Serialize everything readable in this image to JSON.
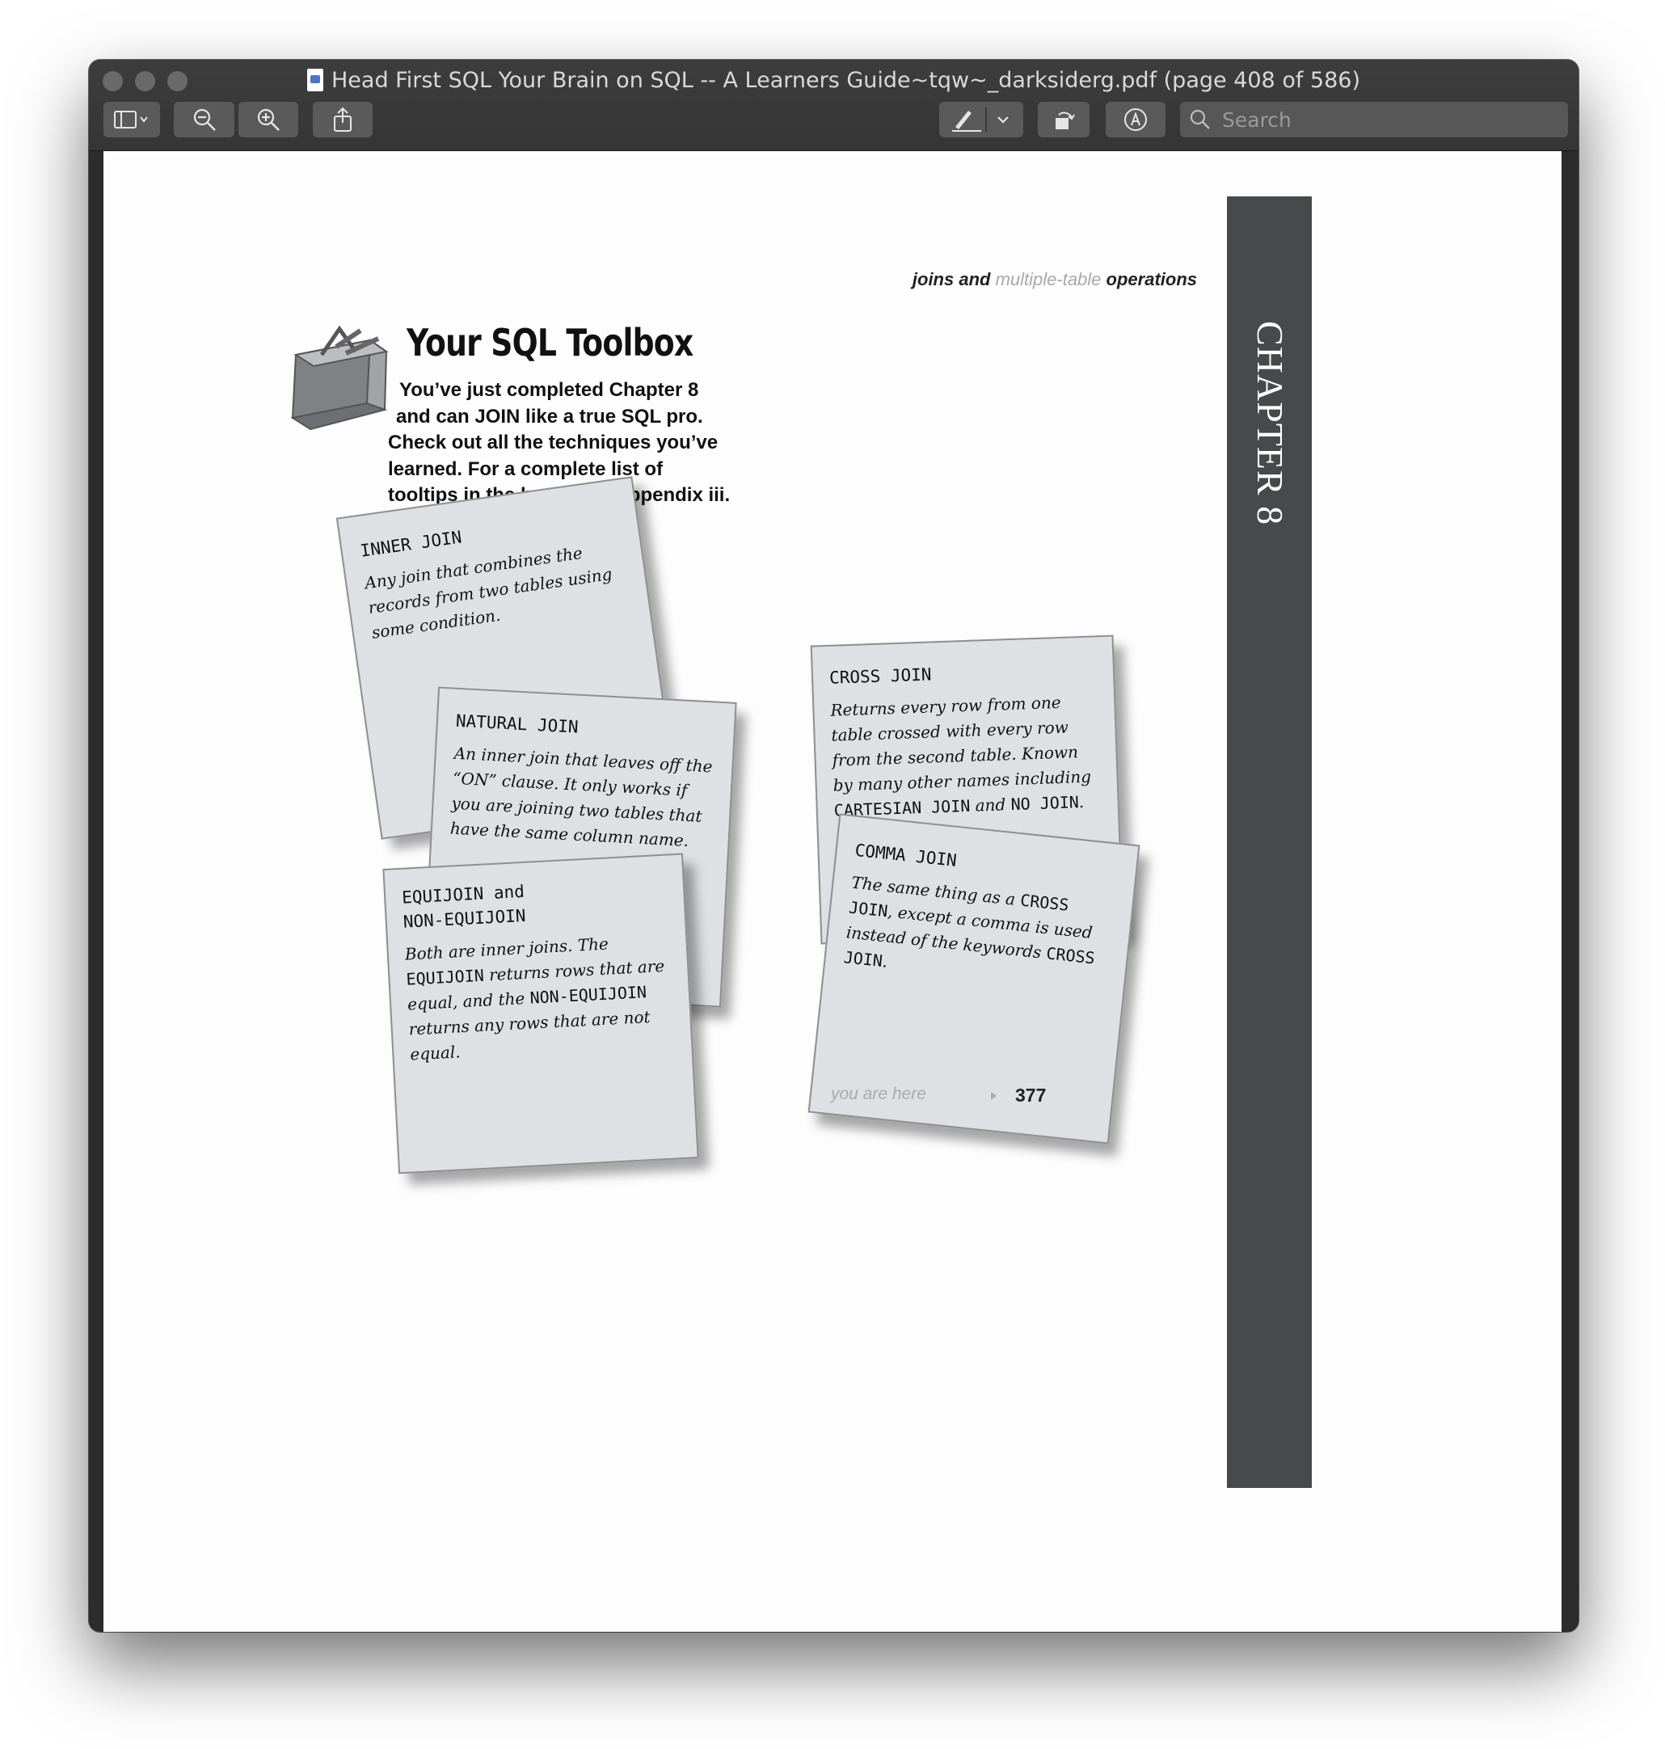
{
  "window": {
    "title": "Head First SQL Your Brain on SQL -- A Learners Guide~tqw~_darksiderg.pdf (page 408 of 586)"
  },
  "toolbar": {
    "buttons": [
      {
        "name": "sidebar-toggle",
        "icon": "sidebar-icon"
      },
      {
        "name": "zoom-out",
        "icon": "zoom-out-icon"
      },
      {
        "name": "zoom-in",
        "icon": "zoom-in-icon"
      },
      {
        "name": "share",
        "icon": "share-icon"
      },
      {
        "name": "markup-pen",
        "icon": "pen-icon"
      },
      {
        "name": "rotate",
        "icon": "rotate-icon"
      },
      {
        "name": "annotate",
        "icon": "markup-icon"
      }
    ],
    "search_placeholder": "Search"
  },
  "page": {
    "running_head_1": "joins and ",
    "running_head_2": "multiple-table",
    "running_head_3": " operations",
    "chapter_tab": "CHAPTER 8",
    "toolbox_title": "Your SQL Toolbox",
    "intro_lines": [
      "You’ve just completed Chapter 8",
      "and can JOIN like a true SQL pro.",
      "Check out all the techniques you’ve",
      "learned. For a complete list of",
      "tooltips in the book, see Appendix iii."
    ],
    "cards": {
      "inner": {
        "title": "INNER JOIN",
        "text": "Any join that combines the records from two tables using some condition."
      },
      "natural": {
        "title": "NATURAL JOIN",
        "text": "An inner join that leaves off the “ON” clause. It only works if you are joining two tables that have the same column name."
      },
      "equi": {
        "title": "EQUIJOIN and\nNON-EQUIJOIN",
        "text_1": "Both are inner joins. The ",
        "kw_1": "EQUIJOIN",
        "text_2": " returns rows that are equal, and the ",
        "kw_2": "NON-EQUIJOIN",
        "text_3": " returns any rows that are not equal."
      },
      "cross": {
        "title": "CROSS JOIN",
        "text_1": "Returns every row from one table crossed with every row from the second table. Known by many other names including ",
        "kw_1": "CARTESIAN JOIN",
        "text_2": " and ",
        "kw_2": "NO JOIN",
        "text_3": "."
      },
      "comma": {
        "title": "COMMA JOIN",
        "text_1": "The same thing as a ",
        "kw_1": "CROSS JOIN",
        "text_2": ", except a comma is used instead of the keywords ",
        "kw_2": "CROSS JOIN",
        "text_3": "."
      }
    },
    "footer_you_are_here": "you are here",
    "page_number": "377"
  },
  "colors": {
    "card_fill": "#dfe0e3",
    "chapter_bar": "#48494b",
    "titlebar": "#3a3a3a"
  }
}
